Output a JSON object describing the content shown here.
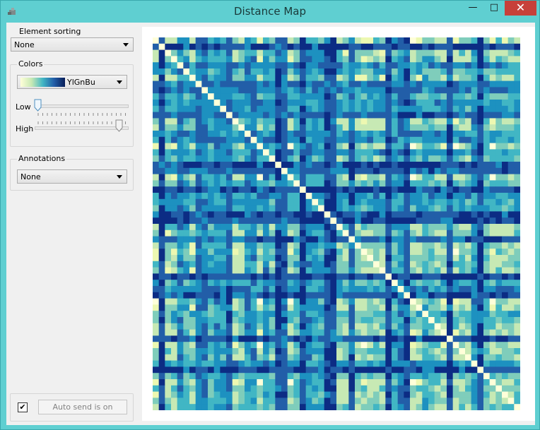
{
  "window": {
    "title": "Distance Map",
    "minimize_glyph": "—",
    "maximize_glyph": "□",
    "close_glyph": "✕"
  },
  "sidebar": {
    "element_sorting": {
      "title": "Element sorting",
      "selected": "None"
    },
    "colors": {
      "title": "Colors",
      "palette": "YlGnBu",
      "low_label": "Low",
      "high_label": "High",
      "low_value": 0.0,
      "high_value": 1.0
    },
    "annotations": {
      "title": "Annotations",
      "selected": "None"
    },
    "auto_send": {
      "checked": true,
      "check_glyph": "✔",
      "label": "Auto send is on"
    }
  },
  "colors": {
    "palette_stops": [
      "#ffffd9",
      "#edf8b1",
      "#c7e9b4",
      "#7fcdbb",
      "#41b6c4",
      "#1d91c0",
      "#225ea8",
      "#0c2c84"
    ],
    "title_bar": "#5fcfd1",
    "close_button": "#c7403a"
  },
  "chart_data": {
    "type": "heatmap",
    "title": "",
    "rows": 60,
    "cols": 60,
    "colormap": "YlGnBu",
    "value_range": [
      0,
      1
    ],
    "note_symmetric": true
  }
}
